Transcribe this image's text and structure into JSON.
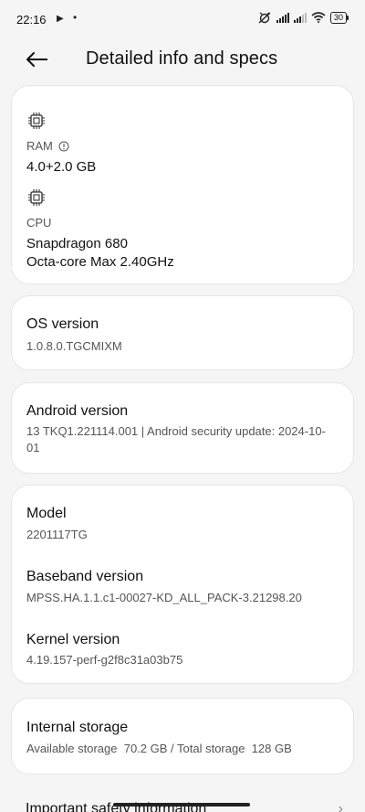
{
  "status_bar": {
    "time": "22:16",
    "battery": "30"
  },
  "header": {
    "title": "Detailed info and specs"
  },
  "hardware": {
    "ram_label": "RAM",
    "ram_value": "4.0+2.0 GB",
    "cpu_label": "CPU",
    "cpu_line1": "Snapdragon 680",
    "cpu_line2": "Octa-core Max 2.40GHz"
  },
  "os": {
    "title": "OS version",
    "value": "1.0.8.0.TGCMIXM"
  },
  "android": {
    "title": "Android version",
    "value": "13 TKQ1.221114.001 | Android security update: 2024-10-01"
  },
  "device": {
    "model_title": "Model",
    "model_value": "2201117TG",
    "baseband_title": "Baseband version",
    "baseband_value": "MPSS.HA.1.1.c1-00027-KD_ALL_PACK-3.21298.20",
    "kernel_title": "Kernel version",
    "kernel_value": "4.19.157-perf-g2f8c31a03b75"
  },
  "storage": {
    "title": "Internal storage",
    "value": "Available storage  70.2 GB / Total storage  128 GB"
  },
  "bottom": {
    "partial_label": "Important safety information",
    "chevron": "›"
  },
  "icons": {
    "back": "arrow-left-icon",
    "chip": "chip-icon",
    "info": "info-icon"
  }
}
